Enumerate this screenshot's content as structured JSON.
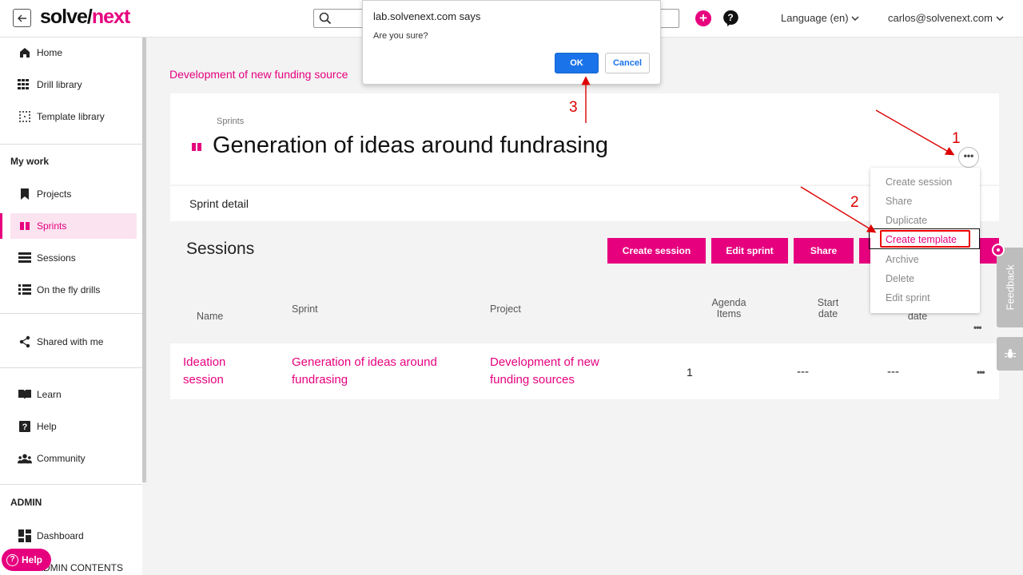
{
  "app": {
    "logo_part1": "solve/",
    "logo_part2": "next",
    "language": "Language (en)",
    "user": "carlos@solvenext.com",
    "plus_label": "+"
  },
  "sidebar": {
    "items": [
      {
        "label": "Home"
      },
      {
        "label": "Drill library"
      },
      {
        "label": "Template library"
      },
      {
        "label": "Projects"
      },
      {
        "label": "Sprints"
      },
      {
        "label": "Sessions"
      },
      {
        "label": "On the fly drills"
      },
      {
        "label": "Shared with me"
      },
      {
        "label": "Learn"
      },
      {
        "label": "Help"
      },
      {
        "label": "Community"
      },
      {
        "label": "Dashboard"
      },
      {
        "label": "ADMIN CONTENTS"
      }
    ],
    "section_my_work": "My work",
    "section_admin": "ADMIN",
    "help_pill": "Help"
  },
  "main": {
    "breadcrumb": "Development of new funding source",
    "sprints_label": "Sprints",
    "title": "Generation of ideas around fundrasing",
    "more_label": "•••",
    "detail_label": "Sprint detail",
    "sessions_heading": "Sessions",
    "buttons": {
      "create_session": "Create session",
      "edit_sprint": "Edit sprint",
      "share": "Share"
    },
    "table": {
      "headers": {
        "name": "Name",
        "sprint": "Sprint",
        "project": "Project",
        "agenda_line1": "Agenda",
        "agenda_line2": "Items",
        "start_line1": "Start",
        "start_line2": "date",
        "end_line2": "date",
        "more": "•••"
      },
      "rows": [
        {
          "name_line1": "Ideation",
          "name_line2": "session",
          "sprint_line1": "Generation of ideas around",
          "sprint_line2": "fundrasing",
          "project_line1": "Development of new",
          "project_line2": "funding sources",
          "agenda_items": "1",
          "start_date": "---",
          "end_date": "---",
          "more": "•••"
        }
      ]
    }
  },
  "dropdown": {
    "items": [
      {
        "label": "Create session"
      },
      {
        "label": "Share"
      },
      {
        "label": "Duplicate"
      },
      {
        "label": "Create template"
      },
      {
        "label": "Archive"
      },
      {
        "label": "Delete"
      },
      {
        "label": "Edit sprint"
      }
    ]
  },
  "feedback": {
    "label": "Feedback"
  },
  "dialog": {
    "title": "lab.solvenext.com says",
    "message": "Are you sure?",
    "ok": "OK",
    "cancel": "Cancel"
  },
  "annotations": {
    "one": "1",
    "two": "2",
    "three": "3",
    "color": "#dd0000"
  },
  "colors": {
    "brand": "#e6007e",
    "dialog_blue": "#1a73e8"
  }
}
